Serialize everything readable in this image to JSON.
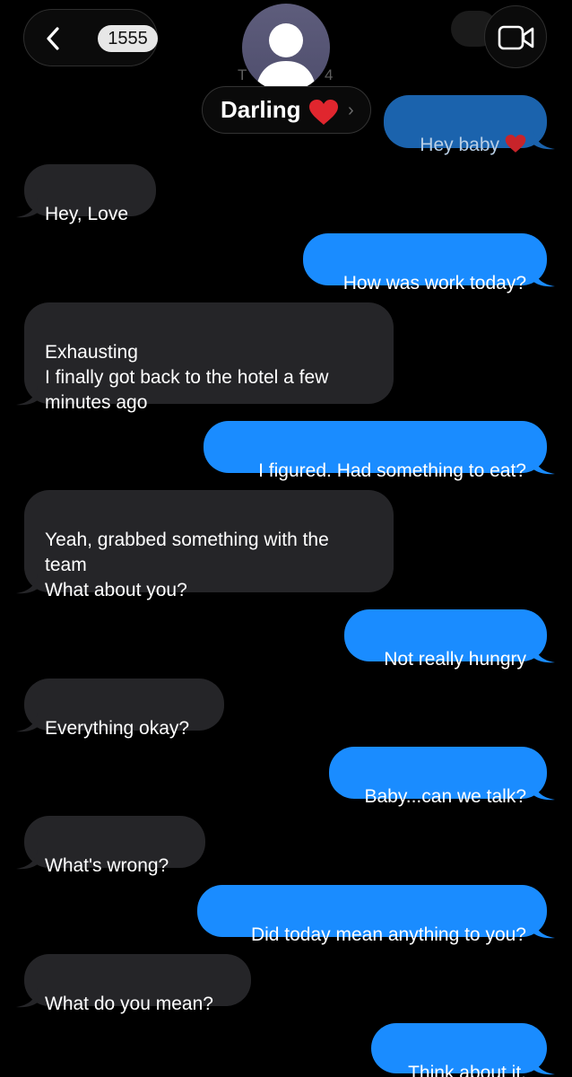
{
  "header": {
    "back_count": "1555",
    "contact_name": "Darling",
    "name_emoji": "❤️",
    "peek_left_text": "T",
    "peek_right_text": "4"
  },
  "colors": {
    "sent_bubble": "#1a8cff",
    "received_bubble": "#252528",
    "background": "#000000"
  },
  "icons": {
    "back": "chevron-left-icon",
    "avatar": "person-silhouette-icon",
    "video": "video-camera-icon",
    "heart": "red-heart-icon"
  },
  "messages": [
    {
      "from": "me",
      "text": "Hey baby",
      "emoji": "❤️"
    },
    {
      "from": "them",
      "text": "Hey, Love"
    },
    {
      "from": "me",
      "text": "How was work today?"
    },
    {
      "from": "them",
      "text": "Exhausting\nI finally got back to the hotel a few\nminutes ago"
    },
    {
      "from": "me",
      "text": "I figured. Had something to eat?"
    },
    {
      "from": "them",
      "text": "Yeah, grabbed something with the\nteam\nWhat about you?"
    },
    {
      "from": "me",
      "text": "Not really hungry"
    },
    {
      "from": "them",
      "text": "Everything okay?"
    },
    {
      "from": "me",
      "text": "Baby...can we talk?"
    },
    {
      "from": "them",
      "text": "What's wrong?"
    },
    {
      "from": "me",
      "text": "Did today mean anything to you?"
    },
    {
      "from": "them",
      "text": "What do you mean?"
    },
    {
      "from": "me",
      "text": "Think about it."
    }
  ]
}
